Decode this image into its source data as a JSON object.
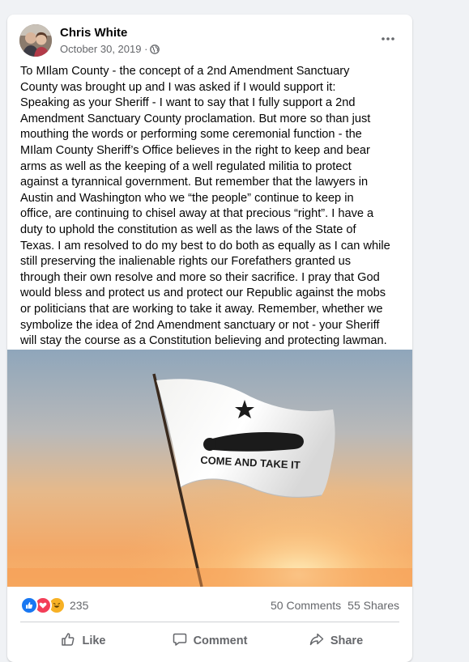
{
  "post": {
    "author": "Chris White",
    "date": "October 30, 2019 ·",
    "privacy_icon": "globe-icon",
    "more_icon": "more-options-icon",
    "text": "To MIlam County - the concept of a 2nd Amendment Sanctuary\nCounty was brought up and I was asked if I would support it:\nSpeaking as your Sheriff - I want to say that I fully support a 2nd\nAmendment Sanctuary County proclamation.  But more so than just\nmouthing the words or performing some ceremonial function - the\nMIlam County Sheriff’s Office believes in the right to keep and bear\narms as well as the keeping of a well regulated militia to protect\nagainst a tyrannical government. But remember that the lawyers in\nAustin and Washington who we “the people” continue to keep in\noffice, are continuing to chisel away at that precious “right”.  I have a\nduty to uphold the constitution as well as the laws of the State of\nTexas. I am resolved to do my best to do both as equally as I can while\nstill preserving the inalienable rights our Forefathers granted us\nthrough their own resolve and more so their sacrifice. I pray that God\nwould bless and protect us and protect our Republic against the mobs\nor politicians that are working to take it away.  Remember, whether we\nsymbolize the idea of 2nd Amendment sanctuary or not - your Sheriff\nwill stay the course as a Constitution believing and protecting lawman.",
    "photo": {
      "flag_text": "COME AND TAKE IT"
    }
  },
  "engagement": {
    "reaction_icons": [
      "like-icon",
      "love-icon",
      "haha-icon"
    ],
    "reaction_count": "235",
    "comments": "50 Comments",
    "shares": "55 Shares"
  },
  "actions": {
    "like": "Like",
    "comment": "Comment",
    "share": "Share"
  },
  "colors": {
    "page_bg": "#f0f2f5",
    "card_bg": "#ffffff",
    "secondary_text": "#65676b",
    "like_blue": "#1877f2",
    "love_red": "#f33e58",
    "haha_yellow": "#f7b125"
  }
}
